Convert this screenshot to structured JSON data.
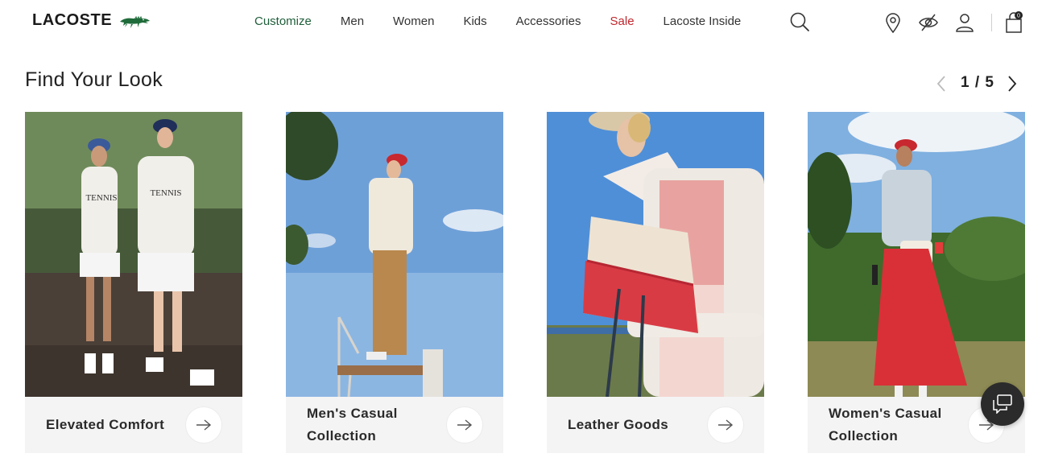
{
  "header": {
    "logo_text": "LACOSTE",
    "nav": [
      {
        "label": "Customize",
        "color": "#1f5e3a"
      },
      {
        "label": "Men"
      },
      {
        "label": "Women"
      },
      {
        "label": "Kids"
      },
      {
        "label": "Accessories"
      },
      {
        "label": "Sale",
        "color": "#c0272d"
      },
      {
        "label": "Lacoste Inside"
      }
    ],
    "icons": [
      "search-icon",
      "store-locator-icon",
      "accessibility-icon",
      "account-icon",
      "bag-icon"
    ],
    "bag_count": "0"
  },
  "section": {
    "title": "Find Your Look",
    "pager": "1 / 5"
  },
  "cards": [
    {
      "label": "Elevated Comfort"
    },
    {
      "label": "Men's Casual Collection"
    },
    {
      "label": "Leather Goods"
    },
    {
      "label": "Women's Casual Collection"
    }
  ],
  "colors": {
    "brand_green": "#1f5e3a",
    "sale_red": "#c0272d",
    "card_footer": "#f4f4f4"
  }
}
